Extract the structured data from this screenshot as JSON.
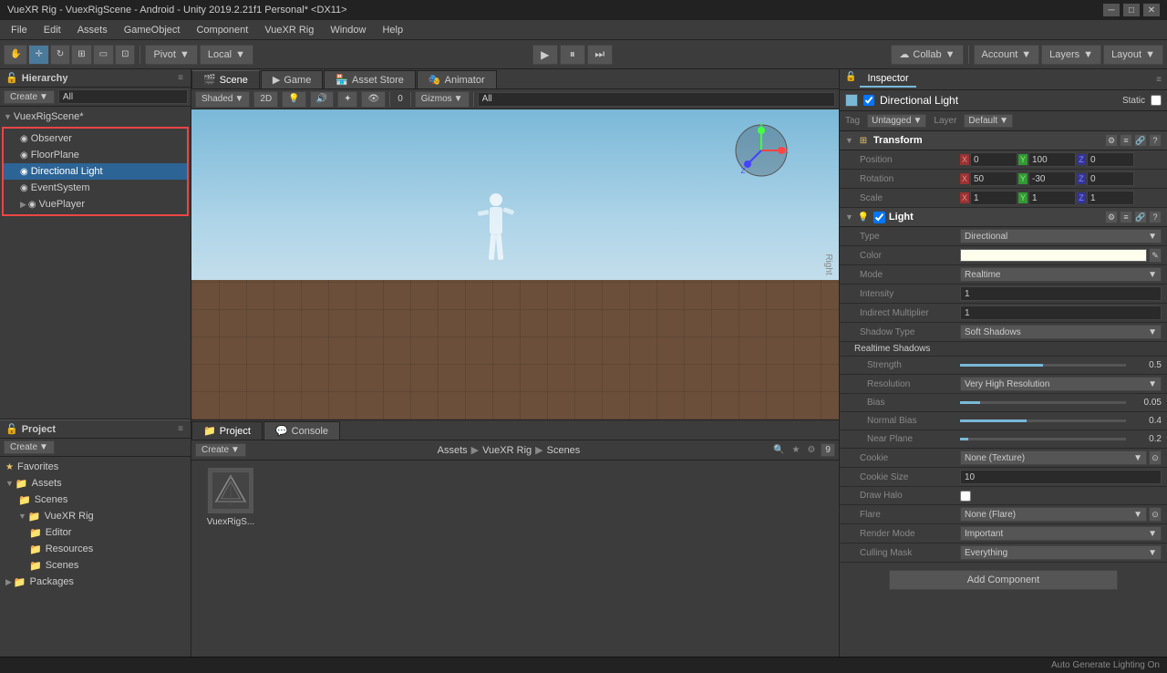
{
  "titleBar": {
    "title": "VueXR Rig - VuexRigScene - Android - Unity 2019.2.21f1 Personal* <DX11>",
    "minBtn": "─",
    "maxBtn": "□",
    "closeBtn": "✕"
  },
  "menuBar": {
    "items": [
      "File",
      "Edit",
      "Assets",
      "GameObject",
      "Component",
      "VueXR Rig",
      "Window",
      "Help"
    ]
  },
  "toolbar": {
    "pivot": "Pivot",
    "local": "Local",
    "account": "Account",
    "layers": "Layers",
    "layout": "Layout",
    "collab": "Collab"
  },
  "hierarchy": {
    "title": "Hierarchy",
    "createBtn": "Create",
    "searchPlaceholder": "All",
    "scene": "VuexRigScene*",
    "items": [
      {
        "label": "Observer",
        "indent": 2,
        "hasArrow": false
      },
      {
        "label": "FloorPlane",
        "indent": 2,
        "hasArrow": false
      },
      {
        "label": "Directional Light",
        "indent": 2,
        "hasArrow": false,
        "selected": true
      },
      {
        "label": "EventSystem",
        "indent": 2,
        "hasArrow": false
      },
      {
        "label": "VuePlayer",
        "indent": 1,
        "hasArrow": true
      }
    ]
  },
  "inspector": {
    "title": "Inspector",
    "objectName": "Directional Light",
    "staticLabel": "Static",
    "tag": "Untagged",
    "layer": "Default",
    "transform": {
      "title": "Transform",
      "position": {
        "label": "Position",
        "x": "0",
        "y": "100",
        "z": "0"
      },
      "rotation": {
        "label": "Rotation",
        "x": "50",
        "y": "-30",
        "z": "0"
      },
      "scale": {
        "label": "Scale",
        "x": "1",
        "y": "1",
        "z": "1"
      }
    },
    "light": {
      "title": "Light",
      "type": {
        "label": "Type",
        "value": "Directional"
      },
      "color": {
        "label": "Color"
      },
      "mode": {
        "label": "Mode",
        "value": "Realtime"
      },
      "intensity": {
        "label": "Intensity",
        "value": "1"
      },
      "indirectMultiplier": {
        "label": "Indirect Multiplier",
        "value": "1"
      },
      "shadowType": {
        "label": "Shadow Type",
        "value": "Soft Shadows"
      },
      "realtimeShadows": "Realtime Shadows",
      "strength": {
        "label": "Strength",
        "value": "0.5",
        "pct": 50
      },
      "resolution": {
        "label": "Resolution",
        "value": "Very High Resolution"
      },
      "bias": {
        "label": "Bias",
        "value": "0.05",
        "pct": 12
      },
      "normalBias": {
        "label": "Normal Bias",
        "value": "0.4",
        "pct": 40
      },
      "nearPlane": {
        "label": "Near Plane",
        "value": "0.2",
        "pct": 5
      },
      "cookie": {
        "label": "Cookie",
        "value": "None (Texture)"
      },
      "cookieSize": {
        "label": "Cookie Size",
        "value": "10"
      },
      "drawHalo": {
        "label": "Draw Halo"
      },
      "flare": {
        "label": "Flare",
        "value": "None (Flare)"
      },
      "renderMode": {
        "label": "Render Mode",
        "value": "Important"
      },
      "cullingMask": {
        "label": "Culling Mask",
        "value": "Everything"
      }
    },
    "addComponent": "Add Component"
  },
  "scene": {
    "tabs": [
      "Scene",
      "Game",
      "Asset Store",
      "Animator"
    ],
    "activeTab": "Scene",
    "shading": "Shaded",
    "mode2D": "2D",
    "gizmos": "Gizmos",
    "searchPlaceholder": "All"
  },
  "project": {
    "tabs": [
      "Project",
      "Console"
    ],
    "activeTab": "Project",
    "createBtn": "Create",
    "breadcrumb": [
      "Assets",
      "VueXR Rig",
      "Scenes"
    ],
    "files": [
      {
        "name": "VuexRigS..."
      }
    ],
    "tree": {
      "favorites": "Favorites",
      "assets": "Assets",
      "scenes": "Scenes",
      "vueXRRig": "VueXR Rig",
      "editor": "Editor",
      "resources": "Resources",
      "scenesFolder": "Scenes",
      "packages": "Packages"
    }
  },
  "statusBar": {
    "text": "Auto Generate Lighting On"
  }
}
